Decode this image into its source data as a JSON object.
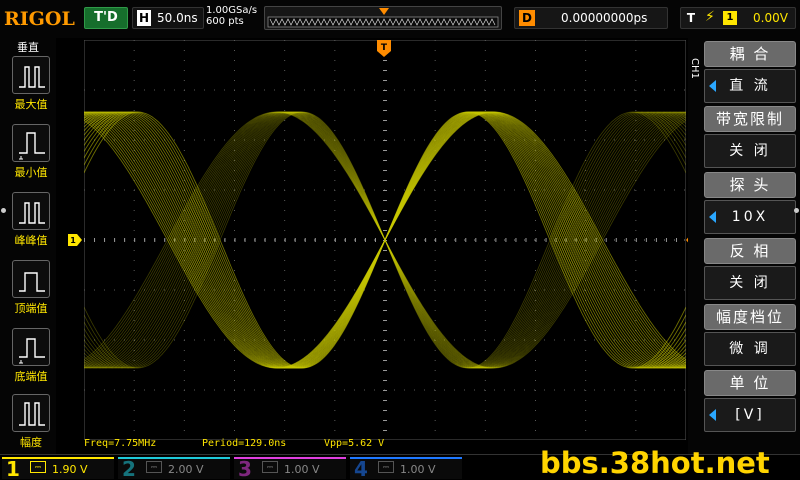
{
  "brand": "RIGOL",
  "top": {
    "mode": "T'D",
    "timebase_label": "H",
    "timebase": "50.0ns",
    "sample_rate": "1.00GSa/s",
    "memory_depth": "600 pts",
    "delay_label": "D",
    "delay": "0.00000000ps",
    "trigger_label": "T",
    "trigger_source": "1",
    "trigger_level": "0.00V"
  },
  "left_menu": {
    "title": "垂直",
    "items": [
      {
        "label": "最大值",
        "icon": "max-value-icon"
      },
      {
        "label": "最小值",
        "icon": "min-value-icon"
      },
      {
        "label": "峰峰值",
        "icon": "peak-peak-icon"
      },
      {
        "label": "顶端值",
        "icon": "top-value-icon"
      },
      {
        "label": "底端值",
        "icon": "base-value-icon"
      },
      {
        "label": "幅度",
        "icon": "amplitude-icon"
      }
    ]
  },
  "right_menu": {
    "channel": "CH1",
    "items": [
      {
        "header": "耦 合",
        "value": "直 流",
        "arrow": true
      },
      {
        "header": "带宽限制",
        "value": "关 闭",
        "arrow": false
      },
      {
        "header": "探 头",
        "value": "10X",
        "arrow": true
      },
      {
        "header": "反 相",
        "value": "关 闭",
        "arrow": false
      },
      {
        "header": "幅度档位",
        "value": "微 调",
        "arrow": false
      },
      {
        "header": "单 位",
        "value": "[V]",
        "arrow": true
      }
    ]
  },
  "markers": {
    "trigger_position": "T",
    "channel_ref": "1",
    "trigger_level": "T"
  },
  "measurements": {
    "freq": "Freq=7.75MHz",
    "period": "Period=129.0ns",
    "vpp": "Vpp=5.62 V"
  },
  "channels": [
    {
      "num": "1",
      "scale": "1.90 V",
      "color": "#ffe600"
    },
    {
      "num": "2",
      "scale": "2.00 V",
      "color": "#1ec8d8"
    },
    {
      "num": "3",
      "scale": "1.00 V",
      "color": "#e040e0"
    },
    {
      "num": "4",
      "scale": "1.00 V",
      "color": "#1f78ff"
    }
  ],
  "watermark": "bbs.38hot.net",
  "colors": {
    "trace": "#c8c800",
    "accent": "#ff8c00",
    "ch1": "#ffe600"
  }
}
